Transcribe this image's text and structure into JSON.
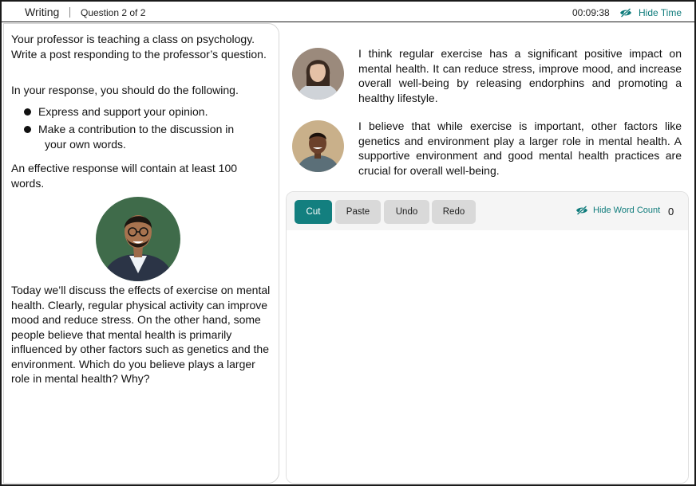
{
  "header": {
    "section_title": "Writing",
    "question_counter": "Question 2 of 2",
    "timer": "00:09:38",
    "hide_time_label": "Hide Time",
    "accent_color": "#0e7b7b"
  },
  "prompt": {
    "intro": "Your professor is teaching a class on psychology.  Write a post responding to the professor’s question.",
    "instruction": "In your response, you should do the following.",
    "bullets": [
      "Express and support your opinion.",
      "Make a contribution to the discussion in",
      "your own words."
    ],
    "requirement": "An effective response will contain at least 100 words.",
    "professor_text": "Today we’ll discuss the effects of exercise on mental health.  Clearly, regular physical activity can improve mood and reduce stress.  On the other hand, some people believe that mental health is primarily influenced by other factors such as genetics and the environment.  Which do you believe plays a larger role in mental health? Why?"
  },
  "discussion": {
    "replies": [
      "I think regular exercise has a significant positive impact on mental health.  It can reduce stress, improve mood, and increase overall well-being by releasing endorphins and promoting a healthy lifestyle.",
      "I believe that while exercise is important, other factors like genetics and environment play a larger role in mental health.  A supportive environment and good mental health practices are crucial for overall well-being."
    ]
  },
  "editor": {
    "cut_label": "Cut",
    "paste_label": "Paste",
    "undo_label": "Undo",
    "redo_label": "Redo",
    "hide_word_count_label": "Hide Word Count",
    "word_count": "0",
    "text_value": ""
  }
}
